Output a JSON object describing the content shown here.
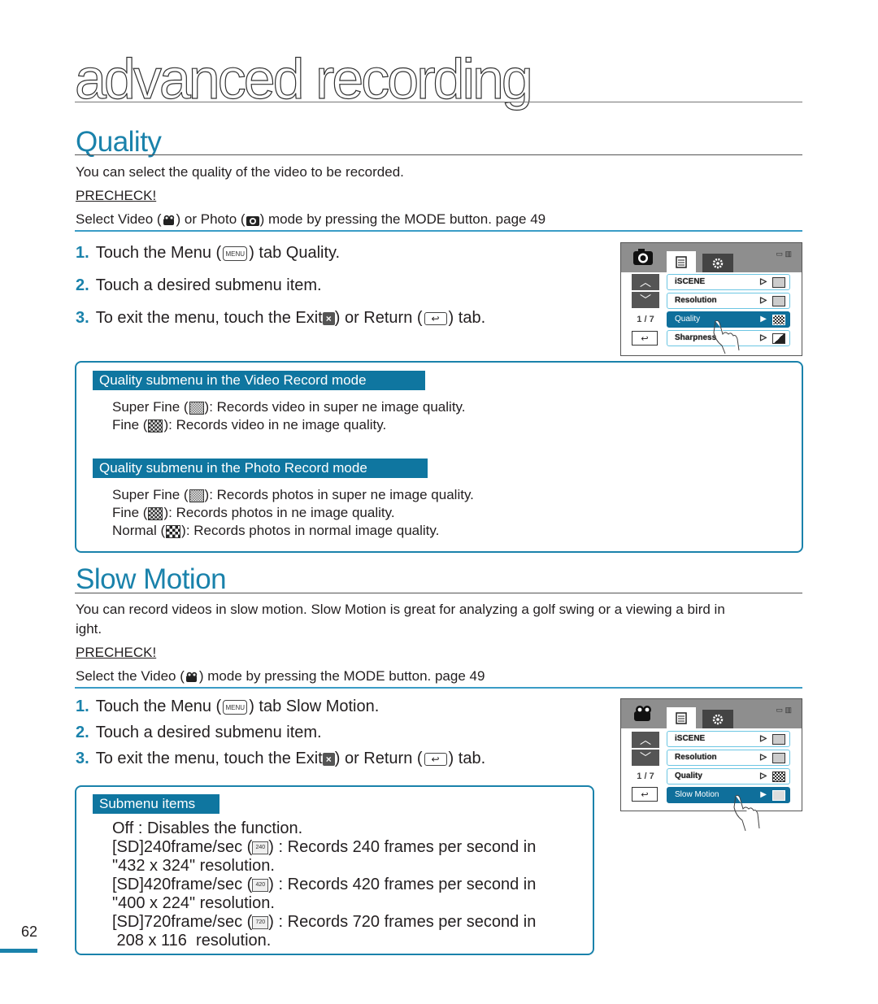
{
  "chapter_title": "advanced recording",
  "page_number": "62",
  "quality": {
    "title": "Quality",
    "intro": "You can select the quality of the video to be recorded.",
    "precheck_label": "PRECHECK!",
    "precheck": {
      "pre": "Select Video (",
      "mid": ") or Photo (",
      "post": ") mode by pressing the MODE button.   page 49"
    },
    "steps": [
      {
        "num": "1.",
        "pre": "Touch the Menu (",
        "menu_icon": "MENU",
        "post": ") tab      Quality."
      },
      {
        "num": "2.",
        "text": "Touch a desired submenu item."
      },
      {
        "num": "3.",
        "pre": "To exit the menu, touch the Exit",
        "mid": ") or Return (",
        "post": ") tab."
      }
    ],
    "video_box": {
      "label": "Quality submenu in the Video Record mode",
      "items": [
        {
          "pre": "Super Fine (",
          "post": "): Records video in super  ne image quality.",
          "icon": "super-fine-icon"
        },
        {
          "pre": "Fine (",
          "post": "): Records video in  ne image quality.",
          "icon": "fine-icon"
        }
      ]
    },
    "photo_box": {
      "label": "Quality submenu in the Photo Record mode",
      "items": [
        {
          "pre": "Super Fine (",
          "post": "): Records photos in super  ne image quality.",
          "icon": "super-fine-icon"
        },
        {
          "pre": "Fine (",
          "post": "): Records photos in  ne image quality.",
          "icon": "fine-icon"
        },
        {
          "pre": "Normal (",
          "post": "): Records photos in normal image quality.",
          "icon": "normal-icon"
        }
      ]
    },
    "screen": {
      "mode_icon": "photo-camera-icon",
      "page": "1 / 7",
      "items": [
        {
          "label": "iSCENE",
          "selected": false
        },
        {
          "label": "Resolution",
          "selected": false
        },
        {
          "label": "Quality",
          "selected": true
        },
        {
          "label": "Sharpness",
          "selected": false
        }
      ]
    }
  },
  "slow_motion": {
    "title": "Slow Motion",
    "intro_1": "You can record videos in slow motion.  Slow Motion  is great for analyzing a golf swing or a viewing a bird in",
    "intro_2": " ight.",
    "precheck_label": "PRECHECK!",
    "precheck": {
      "pre": "Select the Video (",
      "post": ") mode by pressing the MODE button.   page 49"
    },
    "steps": [
      {
        "num": "1.",
        "pre": "Touch the Menu (",
        "menu_icon": "MENU",
        "post": ") tab     Slow Motion."
      },
      {
        "num": "2.",
        "text": "Touch a desired submenu item."
      },
      {
        "num": "3.",
        "pre": "To exit the menu, touch the Exit",
        "mid": ") or Return (",
        "post": ") tab."
      }
    ],
    "box": {
      "label": "Submenu items",
      "lines": [
        {
          "text": "Off : Disables the function."
        },
        {
          "pre": "[SD]240frame/sec (",
          "icon_text": "240",
          "post": ") : Records 240 frames per second in"
        },
        {
          "text": "\"432 x 324\" resolution."
        },
        {
          "pre": "[SD]420frame/sec (",
          "icon_text": "420",
          "post": ") : Records 420 frames per second in"
        },
        {
          "text": "\"400 x 224\" resolution."
        },
        {
          "pre": "[SD]720frame/sec (",
          "icon_text": "720",
          "post": ") : Records 720 frames per second in"
        },
        {
          "text": " 208 x 116  resolution."
        }
      ]
    },
    "screen": {
      "mode_icon": "video-camera-icon",
      "page": "1 / 7",
      "items": [
        {
          "label": "iSCENE",
          "selected": false
        },
        {
          "label": "Resolution",
          "selected": false
        },
        {
          "label": "Quality",
          "selected": false
        },
        {
          "label": "Slow Motion",
          "selected": true
        }
      ]
    }
  },
  "colors": {
    "accent": "#1a82ab",
    "label_bg": "#0f76a0",
    "rule_blue": "#3a9cc6"
  }
}
